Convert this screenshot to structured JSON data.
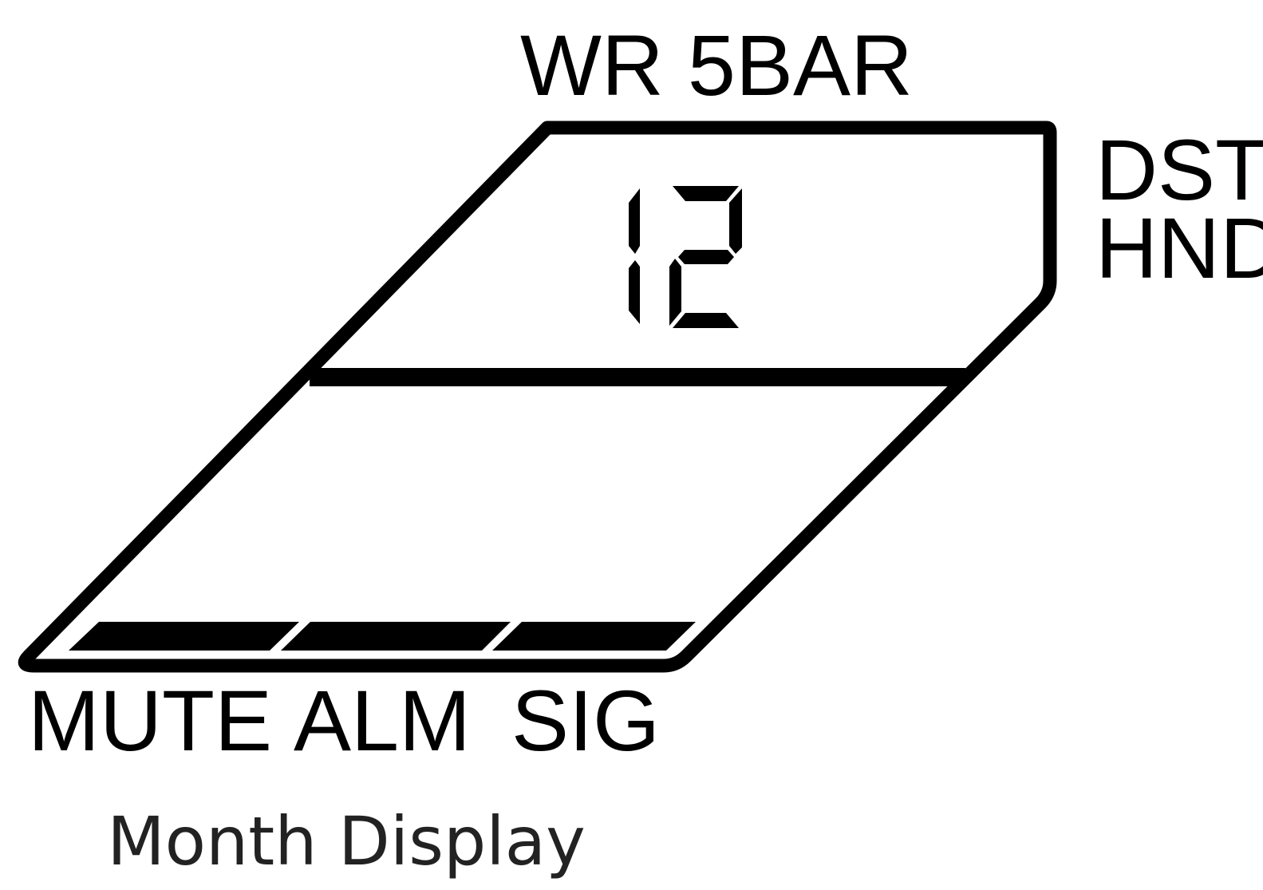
{
  "top_label": "WR 5BAR",
  "right_labels": [
    "DST",
    "HND"
  ],
  "digit_display": "12",
  "indicator_labels": [
    "MUTE",
    "ALM",
    "SIG"
  ],
  "caption": "Month Display",
  "colors": {
    "ink": "#000000",
    "background": "#ffffff",
    "caption": "#222222"
  }
}
